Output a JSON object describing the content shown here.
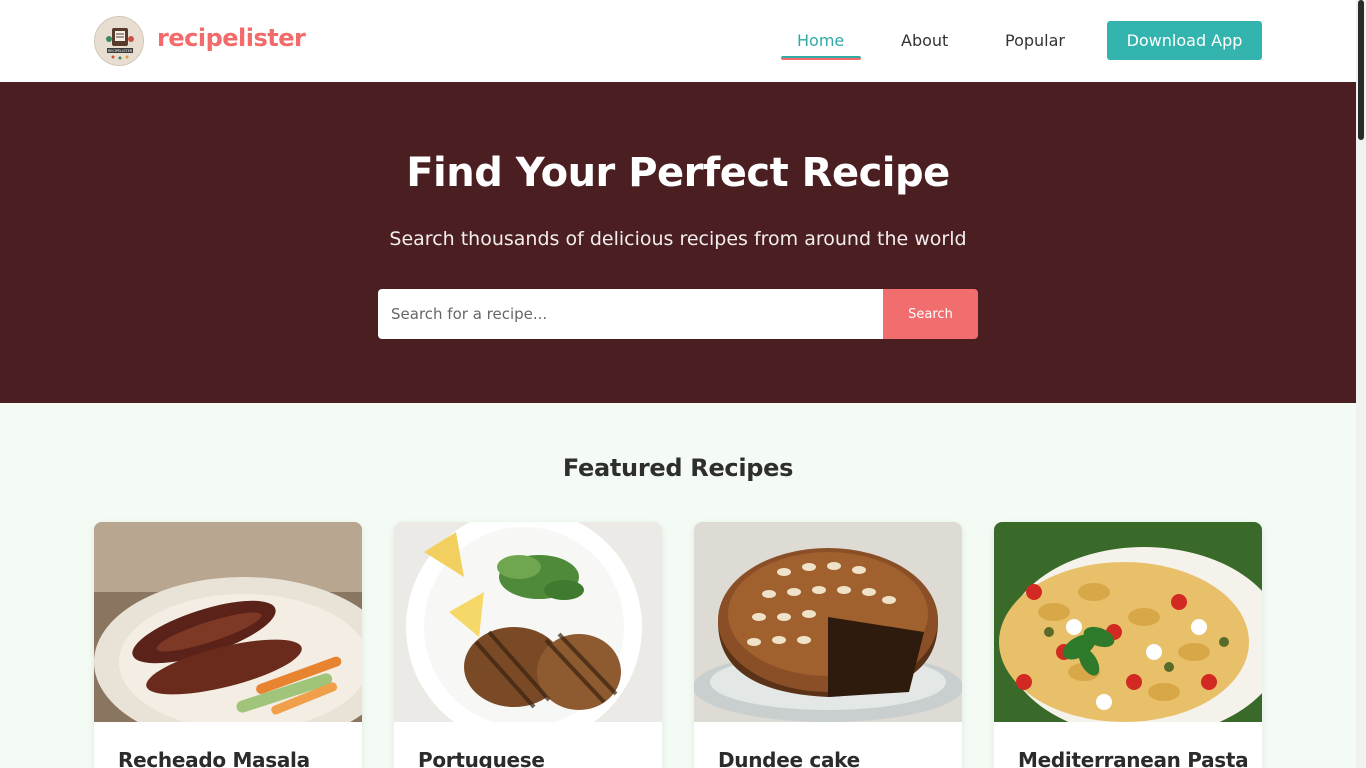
{
  "header": {
    "brand": "recipelister",
    "logo_text": "RECIPELISTER",
    "nav": [
      {
        "label": "Home",
        "active": true
      },
      {
        "label": "About",
        "active": false
      },
      {
        "label": "Popular",
        "active": false
      }
    ],
    "download_label": "Download App"
  },
  "hero": {
    "title": "Find Your Perfect Recipe",
    "subtitle": "Search thousands of delicious recipes from around the world",
    "search_placeholder": "Search for a recipe...",
    "search_button": "Search"
  },
  "featured": {
    "title": "Featured Recipes",
    "cards": [
      {
        "title": "Recheado Masala",
        "image": "fried-fish-plate"
      },
      {
        "title": "Portuguese",
        "image": "grilled-chicken-plate"
      },
      {
        "title": "Dundee cake",
        "image": "almond-fruit-cake"
      },
      {
        "title": "Mediterranean Pasta",
        "image": "farfalle-salad-bowl"
      }
    ]
  },
  "colors": {
    "brand": "#f26a6a",
    "accent": "#33a9a5",
    "hero_bg": "#4b1f21",
    "page_bg": "#f3fbf4"
  }
}
